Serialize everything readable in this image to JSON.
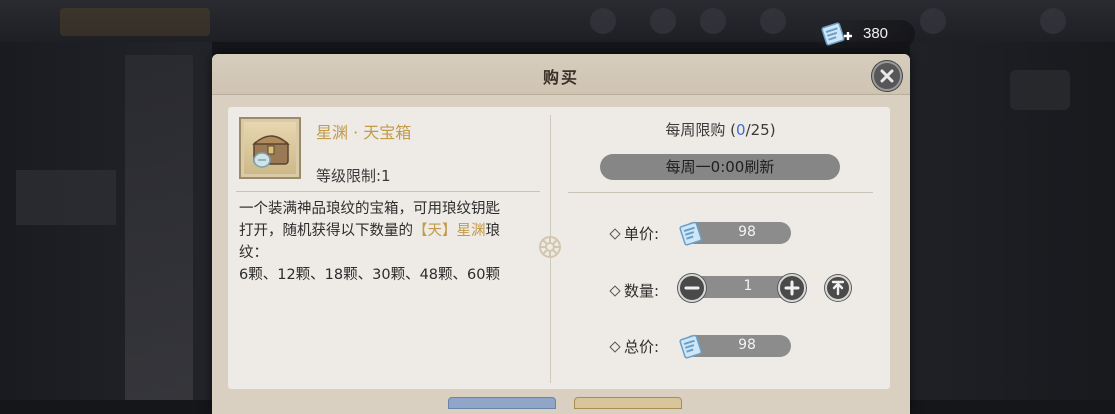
{
  "currency": {
    "value": "380",
    "icon": "ticket-plus-icon"
  },
  "dialog": {
    "title": "购买",
    "close_icon": "close-icon"
  },
  "item": {
    "name": "星渊 · 天宝箱",
    "level": "等级限制:1",
    "icon": "treasure-chest-icon",
    "desc_line1": "一个装满神品琅纹的宝箱，可用琅纹钥匙",
    "desc_line2_a": "打开，随机获得以下数量的",
    "desc_line2_b": "【天】星渊",
    "desc_line2_c": "琅",
    "desc_line3": "纹：",
    "desc_line4": "6颗、12颗、18颗、30颗、48颗、60颗"
  },
  "purchase": {
    "weekly_prefix": "每周限购 (",
    "weekly_current": "0",
    "weekly_suffix": "/25)",
    "refresh_text": "每周一0:00刷新",
    "unit_price_label": "单价:",
    "unit_price": "98",
    "quantity_label": "数量:",
    "quantity": "1",
    "total_label": "总价:",
    "total_price": "98"
  },
  "colors": {
    "highlight": "#c29a4a",
    "limit_current": "#3b6fd6",
    "panel": "#eeebe6",
    "header": "#d7cdbd"
  }
}
